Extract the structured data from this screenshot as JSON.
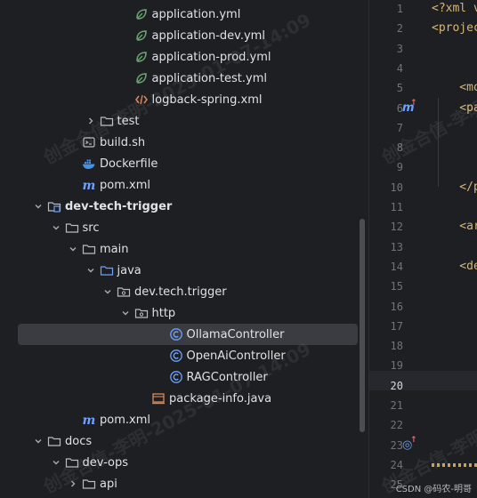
{
  "tree": {
    "rows": [
      {
        "label": "application.yml",
        "icon": "spring-leaf-icon",
        "chevron": "none",
        "indent": 7
      },
      {
        "label": "application-dev.yml",
        "icon": "spring-leaf-icon",
        "chevron": "none",
        "indent": 7
      },
      {
        "label": "application-prod.yml",
        "icon": "spring-leaf-icon",
        "chevron": "none",
        "indent": 7
      },
      {
        "label": "application-test.yml",
        "icon": "spring-leaf-icon",
        "chevron": "none",
        "indent": 7
      },
      {
        "label": "logback-spring.xml",
        "icon": "xml-file-icon",
        "chevron": "none",
        "indent": 7
      },
      {
        "label": "test",
        "icon": "folder-icon",
        "chevron": "right",
        "indent": 5
      },
      {
        "label": "build.sh",
        "icon": "shell-file-icon",
        "chevron": "none",
        "indent": 4
      },
      {
        "label": "Dockerfile",
        "icon": "docker-icon",
        "chevron": "none",
        "indent": 4
      },
      {
        "label": "pom.xml",
        "icon": "maven-icon",
        "chevron": "none",
        "indent": 4
      },
      {
        "label": "dev-tech-trigger",
        "icon": "module-folder-icon",
        "chevron": "down",
        "indent": 2,
        "bold": true
      },
      {
        "label": "src",
        "icon": "folder-icon",
        "chevron": "down",
        "indent": 3
      },
      {
        "label": "main",
        "icon": "folder-icon",
        "chevron": "down",
        "indent": 4
      },
      {
        "label": "java",
        "icon": "source-folder-icon",
        "chevron": "down",
        "indent": 5
      },
      {
        "label": "dev.tech.trigger",
        "icon": "package-icon",
        "chevron": "down",
        "indent": 6
      },
      {
        "label": "http",
        "icon": "package-icon",
        "chevron": "down",
        "indent": 7
      },
      {
        "label": "OllamaController",
        "icon": "class-icon",
        "chevron": "none",
        "indent": 9,
        "selected": true
      },
      {
        "label": "OpenAiController",
        "icon": "class-icon",
        "chevron": "none",
        "indent": 9
      },
      {
        "label": "RAGController",
        "icon": "class-icon",
        "chevron": "none",
        "indent": 9
      },
      {
        "label": "package-info.java",
        "icon": "package-info-icon",
        "chevron": "none",
        "indent": 8
      },
      {
        "label": "pom.xml",
        "icon": "maven-icon",
        "chevron": "none",
        "indent": 4
      },
      {
        "label": "docs",
        "icon": "folder-icon",
        "chevron": "down",
        "indent": 2
      },
      {
        "label": "dev-ops",
        "icon": "folder-icon",
        "chevron": "down",
        "indent": 3
      },
      {
        "label": "api",
        "icon": "folder-icon",
        "chevron": "right",
        "indent": 4
      }
    ]
  },
  "editor": {
    "current_line": "20",
    "gutter": [
      "1",
      "2",
      "3",
      "4",
      "5",
      "6",
      "7",
      "8",
      "9",
      "10",
      "11",
      "12",
      "13",
      "14",
      "15",
      "16",
      "17",
      "18",
      "19",
      "20",
      "21",
      "22",
      "23",
      "24",
      "25"
    ],
    "code": [
      {
        "line": "1",
        "text": "<?xml v"
      },
      {
        "line": "2",
        "text": "<projec"
      },
      {
        "line": "5",
        "text": "    <mo"
      },
      {
        "line": "6",
        "text": "    <pa"
      },
      {
        "line": "10",
        "text": "    </p"
      },
      {
        "line": "12",
        "text": "    <ar"
      },
      {
        "line": "14",
        "text": "    <de"
      }
    ],
    "gutter_icons": [
      {
        "line": "6",
        "glyph": "m",
        "arrow": "↑",
        "name": "maven-override-icon"
      },
      {
        "line": "23",
        "glyph": "◎",
        "arrow": "↑",
        "name": "maven-dependency-icon"
      }
    ]
  },
  "watermark": {
    "text": "创金合信-李明-2025-01-07-14:09"
  },
  "footer": {
    "credit": "CSDN @码农-明哥"
  },
  "colors": {
    "background": "#1e1f22",
    "selection": "#3a3c42",
    "tag": "#d5b778",
    "line_number": "#6f737a"
  }
}
